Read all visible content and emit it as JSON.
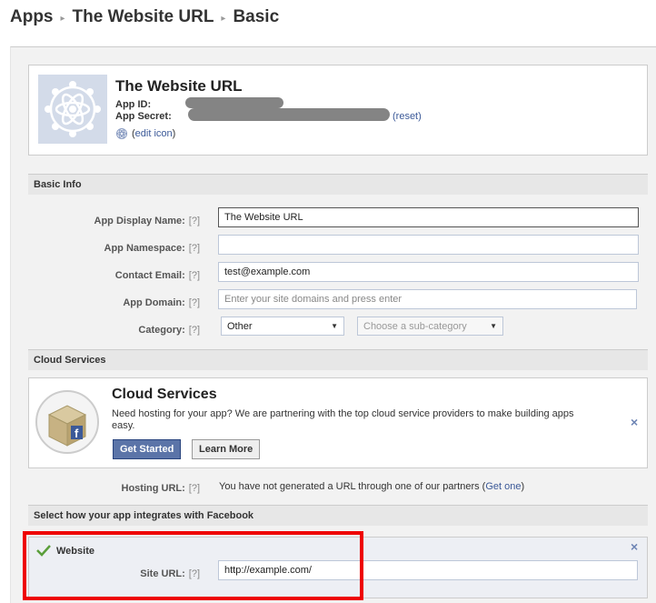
{
  "breadcrumb": {
    "item1": "Apps",
    "item2": "The Website URL",
    "item3": "Basic",
    "sep_glyph": "▸"
  },
  "app": {
    "name": "The Website URL",
    "id_label": "App ID:",
    "secret_label": "App Secret:",
    "reset_link": "(reset)",
    "edit_icon_link": "edit icon",
    "paren_open": "(",
    "paren_close": ")",
    "thumb_icon": "atom-gear-icon"
  },
  "basic_info": {
    "header": "Basic Info",
    "help": "[?]",
    "display_name": {
      "label": "App Display Name:",
      "value": "The Website URL"
    },
    "namespace": {
      "label": "App Namespace:",
      "value": ""
    },
    "contact_email": {
      "label": "Contact Email:",
      "value": "test@example.com"
    },
    "app_domain": {
      "label": "App Domain:",
      "placeholder": "Enter your site domains and press enter"
    },
    "category": {
      "label": "Category:",
      "value": "Other",
      "sub_placeholder": "Choose a sub-category"
    }
  },
  "cloud": {
    "header": "Cloud Services",
    "title": "Cloud Services",
    "description": "Need hosting for your app? We are partnering with the top cloud service providers to make building apps easy.",
    "get_started": "Get Started",
    "learn_more": "Learn More",
    "hosting_label": "Hosting URL:",
    "hosting_text": "You have not generated a URL through one of our partners (",
    "hosting_link": "Get one",
    "hosting_close": ")"
  },
  "integrations": {
    "header": "Select how your app integrates with Facebook",
    "website_title": "Website",
    "site_url_label": "Site URL:",
    "site_url_value": "http://example.com/"
  },
  "close_glyph": "×",
  "caret_glyph": "▼",
  "colors": {
    "link": "#3b5998",
    "primary_button": "#5b74a8",
    "highlight": "#ee0000",
    "check": "#5a9e3a"
  }
}
